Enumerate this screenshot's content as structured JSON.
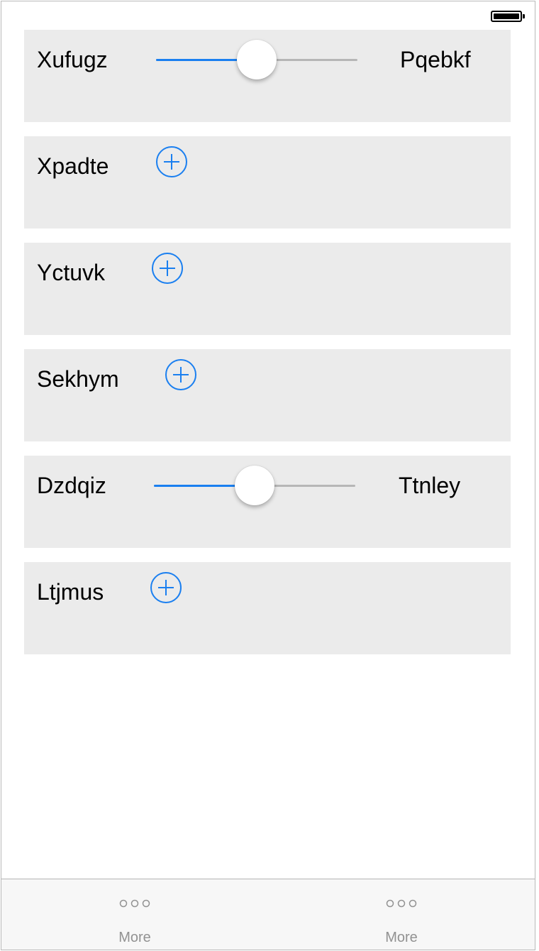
{
  "status_bar": {
    "battery_icon": "battery-full-icon"
  },
  "accent_color": "#1a7ff0",
  "rows": [
    {
      "type": "slider",
      "label": "Xufugz",
      "right_label": "Pqebkf",
      "slider_value": 0.5
    },
    {
      "type": "add",
      "label": "Xpadte",
      "icon": "add-circle-icon"
    },
    {
      "type": "add",
      "label": "Yctuvk",
      "icon": "add-circle-icon"
    },
    {
      "type": "add",
      "label": "Sekhym",
      "icon": "add-circle-icon"
    },
    {
      "type": "slider",
      "label": "Dzdqiz",
      "right_label": "Ttnley",
      "slider_value": 0.5
    },
    {
      "type": "add",
      "label": "Ltjmus",
      "icon": "add-circle-icon"
    }
  ],
  "tab_bar": {
    "items": [
      {
        "label": "More",
        "icon": "more-dots-icon"
      },
      {
        "label": "More",
        "icon": "more-dots-icon"
      }
    ]
  }
}
